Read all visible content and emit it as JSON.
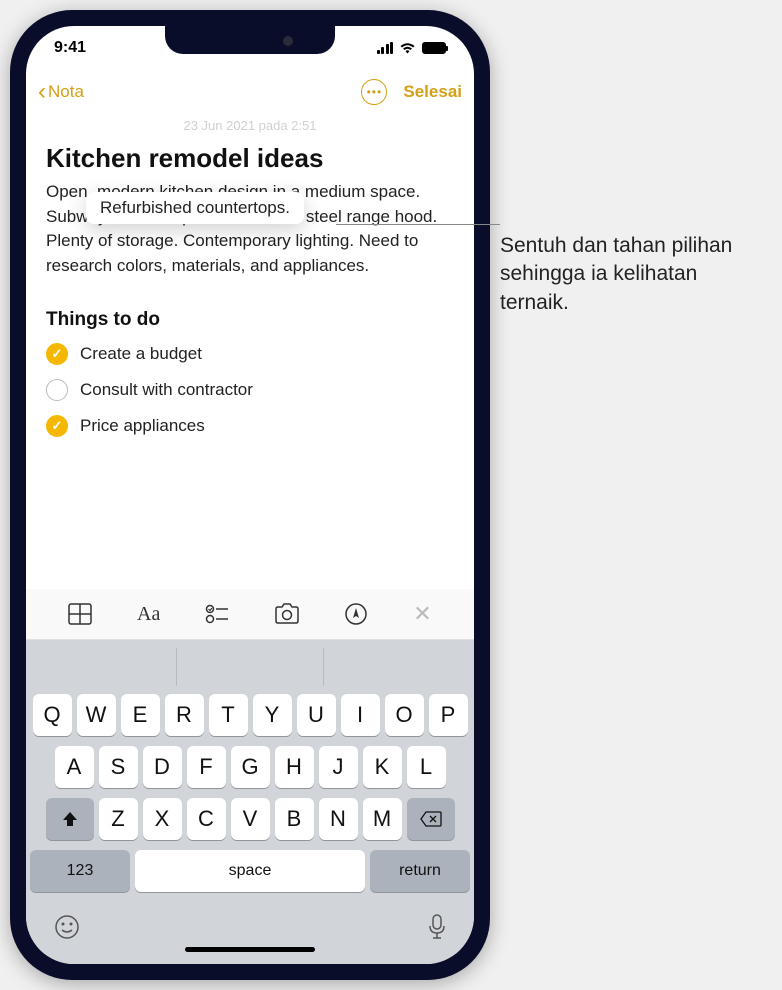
{
  "status": {
    "time": "9:41"
  },
  "nav": {
    "back_label": "Nota",
    "done_label": "Selesai"
  },
  "note": {
    "timestamp": "23 Jun 2021 pada 2:51",
    "title": "Kitchen remodel ideas",
    "body": "Open, modern kitchen design in a medium space. Subway tile backsplash. Stainless steel range hood. Plenty of storage. Contemporary lighting. Need to research colors, materials, and appliances.",
    "tooltip_text": "Refurbished countertops.",
    "section_title": "Things to do",
    "checklist": [
      {
        "label": "Create a budget",
        "checked": true
      },
      {
        "label": "Consult with contractor",
        "checked": false
      },
      {
        "label": "Price appliances",
        "checked": true
      }
    ]
  },
  "keyboard": {
    "row1": [
      "Q",
      "W",
      "E",
      "R",
      "T",
      "Y",
      "U",
      "I",
      "O",
      "P"
    ],
    "row2": [
      "A",
      "S",
      "D",
      "F",
      "G",
      "H",
      "J",
      "K",
      "L"
    ],
    "row3": [
      "Z",
      "X",
      "C",
      "V",
      "B",
      "N",
      "M"
    ],
    "numeric": "123",
    "space": "space",
    "return": "return"
  },
  "callout": {
    "text": "Sentuh dan tahan pilihan sehingga ia kelihatan ternaik."
  }
}
